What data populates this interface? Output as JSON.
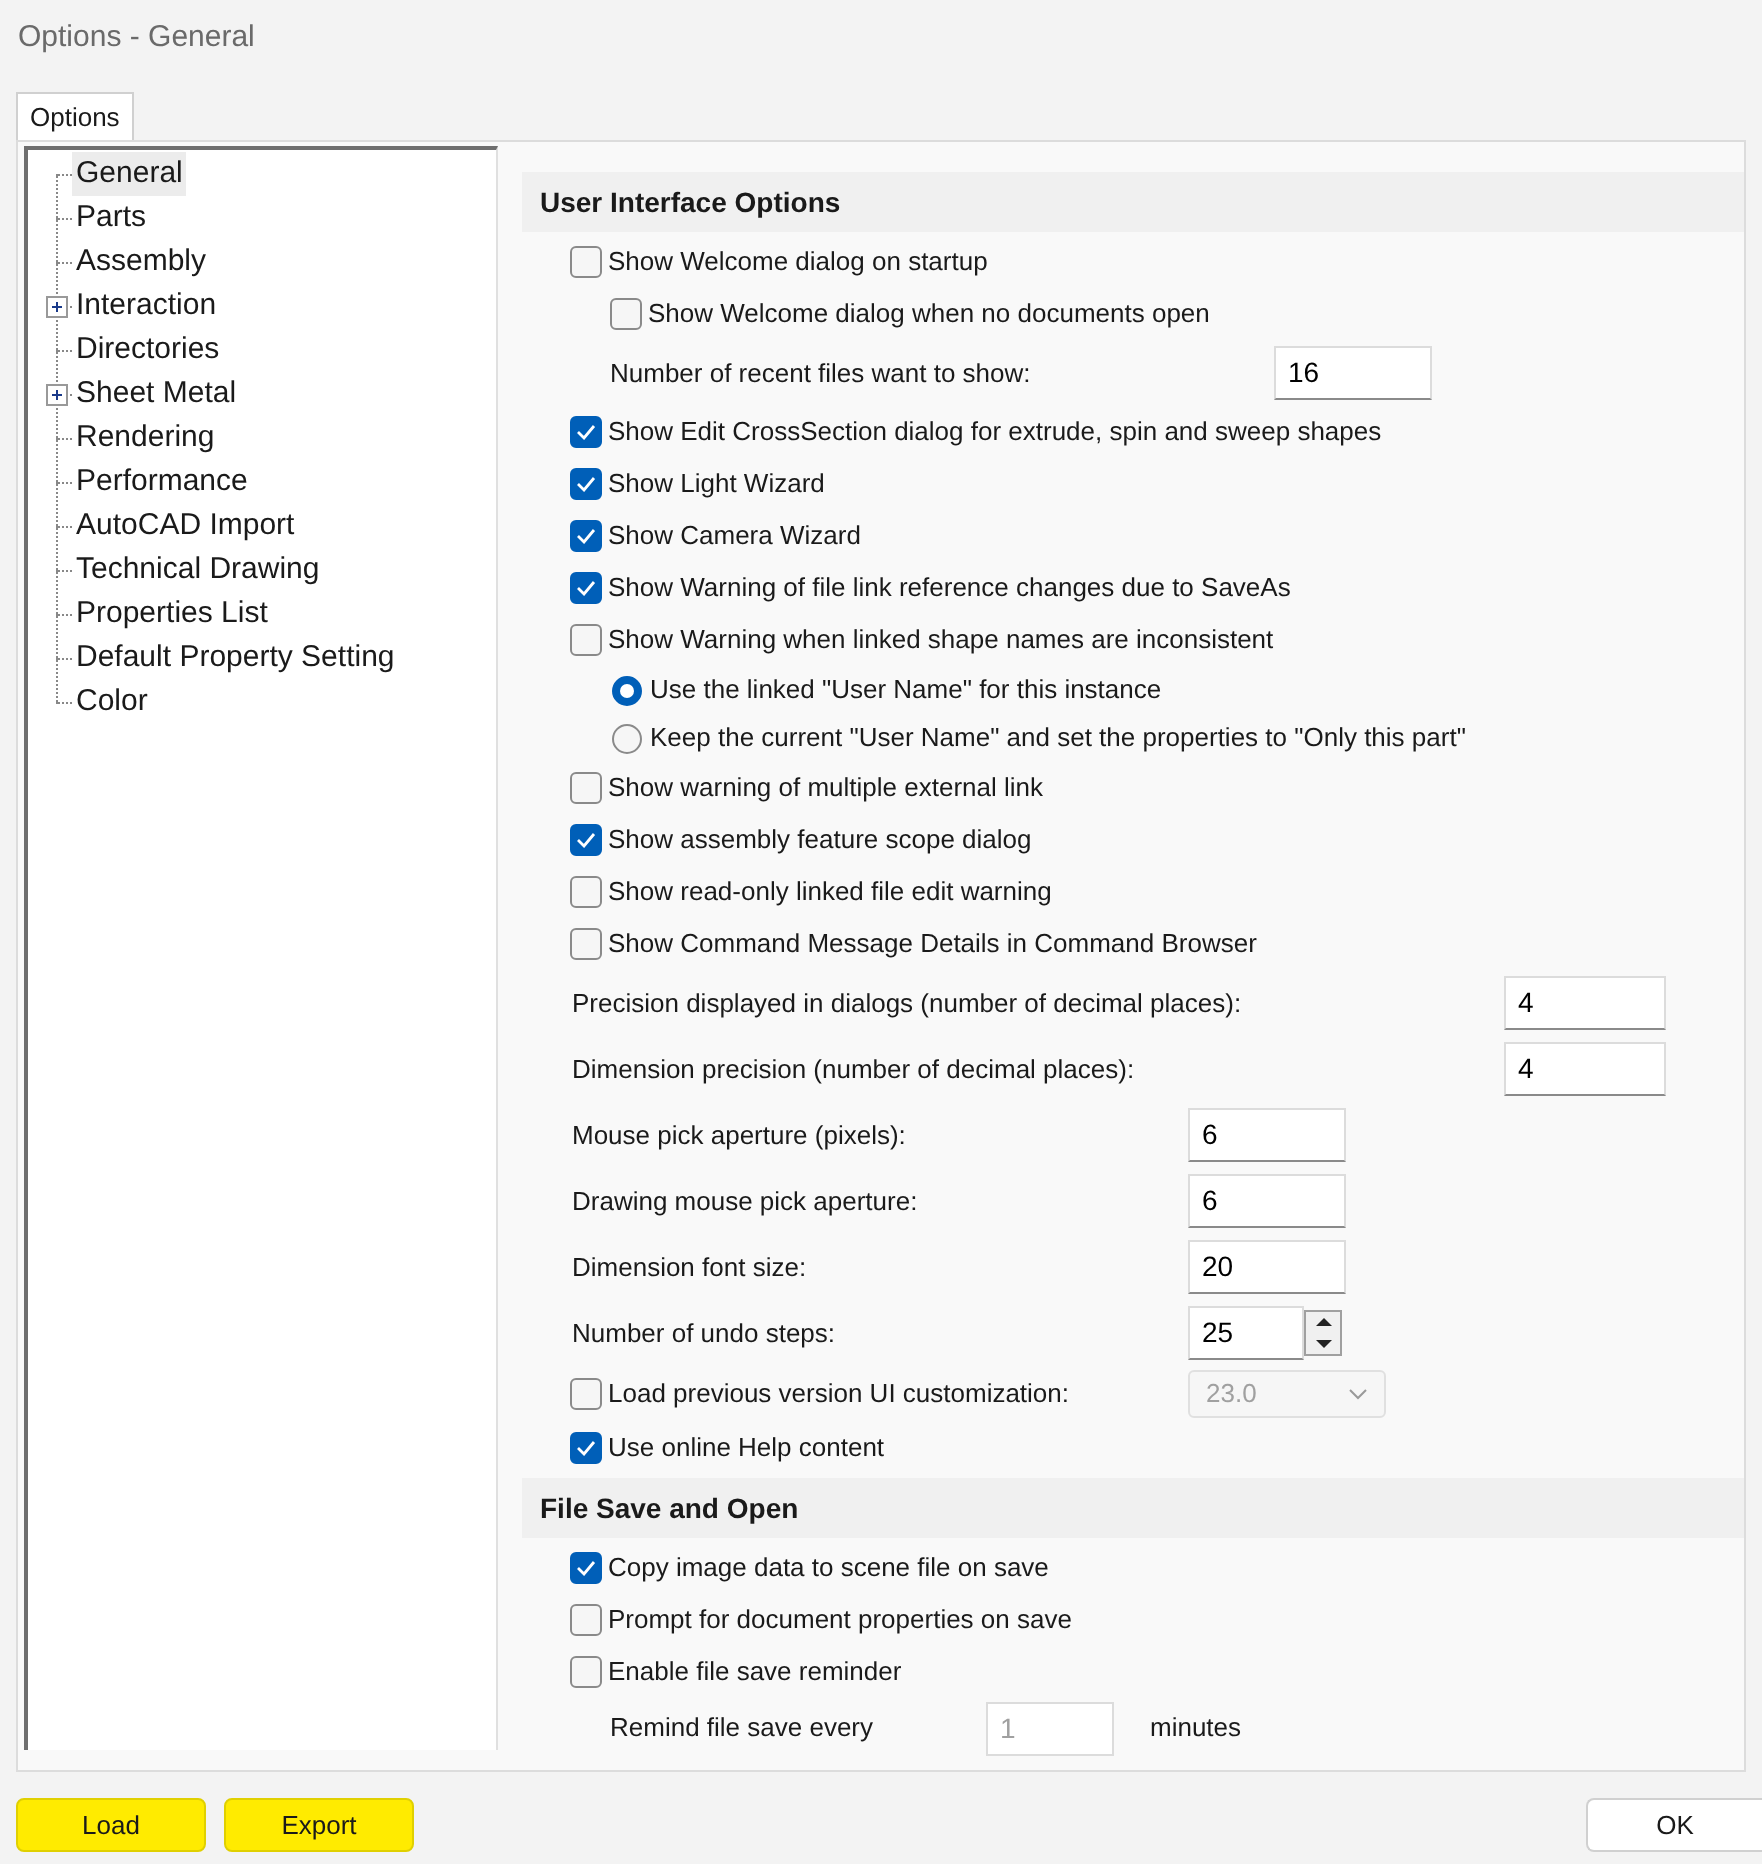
{
  "window": {
    "title": "Options - General"
  },
  "tabs": [
    {
      "label": "Options",
      "selected": true
    }
  ],
  "tree": [
    {
      "label": "General",
      "selected": true,
      "expandable": false
    },
    {
      "label": "Parts",
      "selected": false,
      "expandable": false
    },
    {
      "label": "Assembly",
      "selected": false,
      "expandable": false
    },
    {
      "label": "Interaction",
      "selected": false,
      "expandable": true
    },
    {
      "label": "Directories",
      "selected": false,
      "expandable": false
    },
    {
      "label": "Sheet Metal",
      "selected": false,
      "expandable": true
    },
    {
      "label": "Rendering",
      "selected": false,
      "expandable": false
    },
    {
      "label": "Performance",
      "selected": false,
      "expandable": false
    },
    {
      "label": "AutoCAD Import",
      "selected": false,
      "expandable": false
    },
    {
      "label": "Technical Drawing",
      "selected": false,
      "expandable": false
    },
    {
      "label": "Properties List",
      "selected": false,
      "expandable": false
    },
    {
      "label": "Default Property Setting",
      "selected": false,
      "expandable": false
    },
    {
      "label": "Color",
      "selected": false,
      "expandable": false
    }
  ],
  "options": [
    {
      "kind": "header",
      "label": "User Interface Options"
    },
    {
      "kind": "checkbox",
      "label": "Show Welcome dialog on startup",
      "checked": false
    },
    {
      "kind": "sub_checkbox",
      "label": "Show Welcome dialog when no documents open",
      "checked": false
    },
    {
      "kind": "sub_field",
      "label": "Number of recent files want to show:",
      "value": "16"
    },
    {
      "kind": "checkbox",
      "label": "Show Edit CrossSection dialog for extrude, spin and sweep shapes",
      "checked": true
    },
    {
      "kind": "checkbox",
      "label": "Show Light Wizard",
      "checked": true
    },
    {
      "kind": "checkbox",
      "label": "Show Camera Wizard",
      "checked": true
    },
    {
      "kind": "checkbox",
      "label": "Show Warning of file link reference changes due to SaveAs",
      "checked": true
    },
    {
      "kind": "checkbox",
      "label": "Show Warning when linked shape names are inconsistent",
      "checked": false
    },
    {
      "kind": "radio",
      "label": "Use the linked \"User Name\" for this instance",
      "selected": true
    },
    {
      "kind": "radio",
      "label": "Keep the current \"User Name\" and set the properties to \"Only this part\"",
      "selected": false
    },
    {
      "kind": "checkbox",
      "label": "Show warning of multiple external link",
      "checked": false
    },
    {
      "kind": "checkbox",
      "label": "Show assembly feature scope dialog",
      "checked": true
    },
    {
      "kind": "checkbox",
      "label": "Show read-only linked file edit warning",
      "checked": false
    },
    {
      "kind": "checkbox",
      "label": "Show Command Message Details in Command Browser",
      "checked": false
    },
    {
      "kind": "far_field",
      "label": "Precision displayed in dialogs (number of decimal places):",
      "value": "4"
    },
    {
      "kind": "far_field",
      "label": "Dimension precision (number of decimal places):",
      "value": "4"
    },
    {
      "kind": "field",
      "label": "Mouse pick aperture (pixels):",
      "value": "6"
    },
    {
      "kind": "field",
      "label": "Drawing mouse pick aperture:",
      "value": "6"
    },
    {
      "kind": "field",
      "label": "Dimension font size:",
      "value": "20"
    },
    {
      "kind": "spin",
      "label": "Number of undo steps:",
      "value": "25"
    },
    {
      "kind": "check_combo",
      "label": "Load previous version UI customization:",
      "checked": false,
      "value": "23.0",
      "disabled": true
    },
    {
      "kind": "checkbox",
      "label": "Use online Help content",
      "checked": true
    },
    {
      "kind": "header",
      "label": "File Save and Open"
    },
    {
      "kind": "checkbox",
      "label": "Copy image data to scene file on save",
      "checked": true
    },
    {
      "kind": "checkbox",
      "label": "Prompt for document properties on save",
      "checked": false
    },
    {
      "kind": "checkbox",
      "label": "Enable file save reminder",
      "checked": false
    },
    {
      "kind": "minutes",
      "label": "Remind file save every",
      "value": "1",
      "unit": "minutes",
      "disabled": true
    }
  ],
  "buttons": [
    {
      "label": "Load",
      "highlighted": true
    },
    {
      "label": "Export",
      "highlighted": true
    }
  ],
  "ok_button": {
    "label": "OK"
  }
}
